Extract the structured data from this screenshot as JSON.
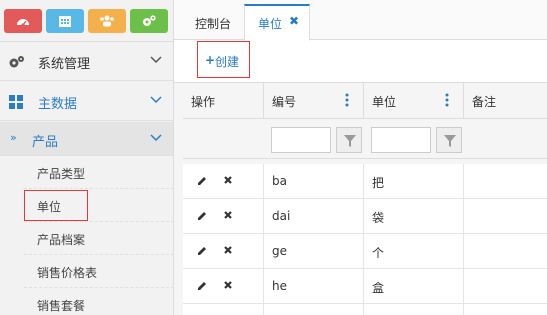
{
  "sidebar": {
    "quick_buttons": [
      {
        "icon": "dashboard-icon",
        "color": "#e25a5a"
      },
      {
        "icon": "calendar-icon",
        "color": "#5ab8e6"
      },
      {
        "icon": "users-icon",
        "color": "#f4b04a"
      },
      {
        "icon": "settings-icon",
        "color": "#6cc04a"
      }
    ],
    "menu": {
      "system": "系统管理",
      "master_data": "主数据",
      "product": "产品"
    },
    "submenu": [
      "产品类型",
      "单位",
      "产品档案",
      "销售价格表",
      "销售套餐"
    ],
    "active_submenu": "单位"
  },
  "tabs": [
    {
      "label": "控制台",
      "active": false
    },
    {
      "label": "单位",
      "active": true,
      "close": "✖"
    }
  ],
  "toolbar": {
    "create_label": "创建",
    "create_icon": "+"
  },
  "grid": {
    "headers": [
      "操作",
      "编号",
      "单位",
      "备注"
    ],
    "rows": [
      {
        "code": "ba",
        "unit": "把"
      },
      {
        "code": "dai",
        "unit": "袋"
      },
      {
        "code": "ge",
        "unit": "个"
      },
      {
        "code": "he",
        "unit": "盒"
      }
    ]
  },
  "colors": {
    "accent": "#2b7cc4",
    "highlight_border": "#e03a3a"
  }
}
